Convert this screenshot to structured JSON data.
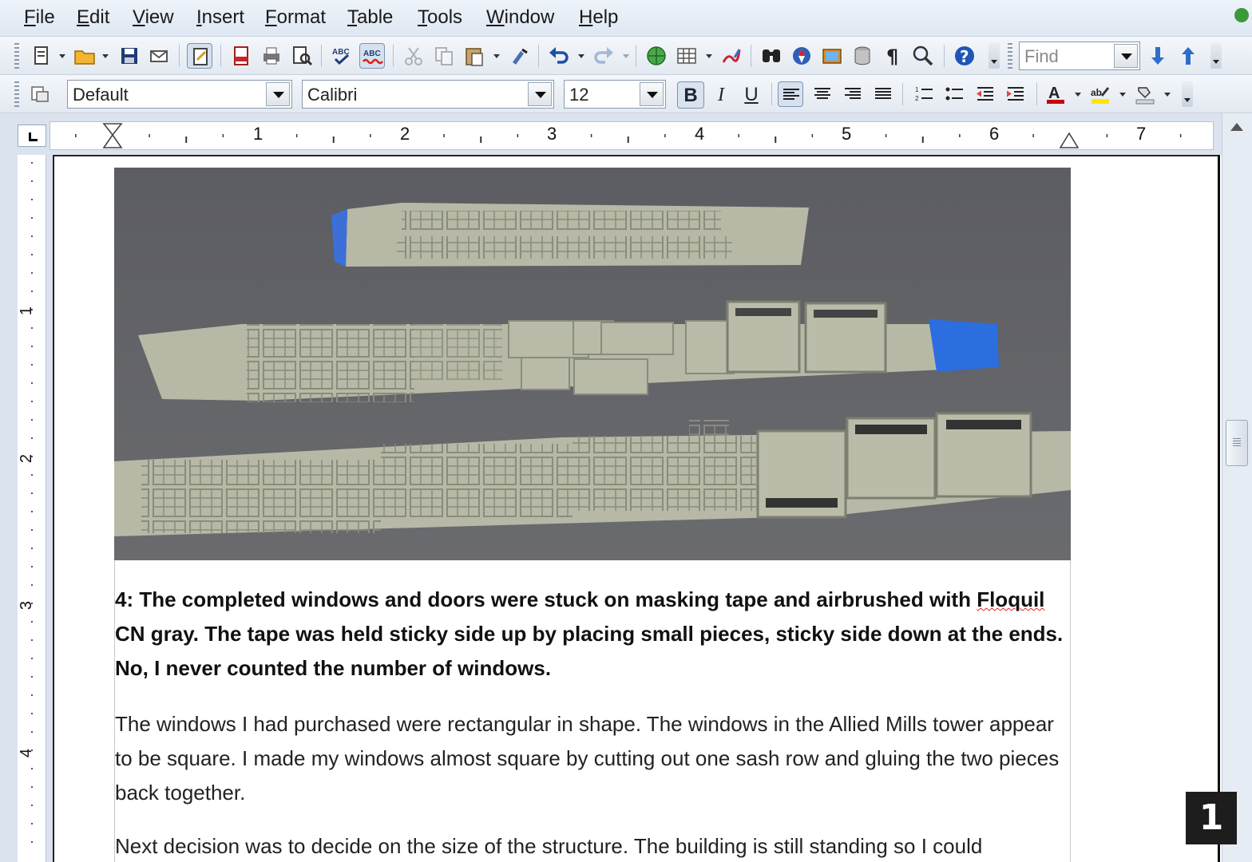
{
  "menu": {
    "file": "File",
    "edit": "Edit",
    "view": "View",
    "insert": "Insert",
    "format": "Format",
    "table": "Table",
    "tools": "Tools",
    "window": "Window",
    "help": "Help"
  },
  "toolbar": {
    "find_placeholder": "Find"
  },
  "formatting": {
    "paragraph_style": "Default",
    "font_name": "Calibri",
    "font_size": "12",
    "bold_label": "B",
    "italic_label": "I",
    "underline_label": "U"
  },
  "ruler": {
    "horizontal_marks": [
      "1",
      "2",
      "3",
      "4",
      "5",
      "6",
      "7"
    ],
    "vertical_marks": [
      "1",
      "2",
      "3",
      "4"
    ]
  },
  "document": {
    "caption_prefix": "4: The completed windows and doors were stuck on masking tape and airbrushed with ",
    "caption_misspelled": "Floquil",
    "caption_suffix": " CN gray. The tape was held sticky side up by placing small pieces, sticky side down at the ends. No, I never counted the number of windows.",
    "paragraph1": "The windows I had purchased were rectangular in shape. The windows in the Allied Mills tower appear to be square. I made my windows almost square by cutting out one sash row and gluing the two pieces back together.",
    "paragraph2": "Next decision was to decide on the size of the structure. The building is still standing so I could"
  },
  "page_badge": "1",
  "colors": {
    "photo_background": "#5f6064",
    "plastic_gray": "#b7b9a6",
    "masking_tape_blue": "#2c6de0"
  }
}
